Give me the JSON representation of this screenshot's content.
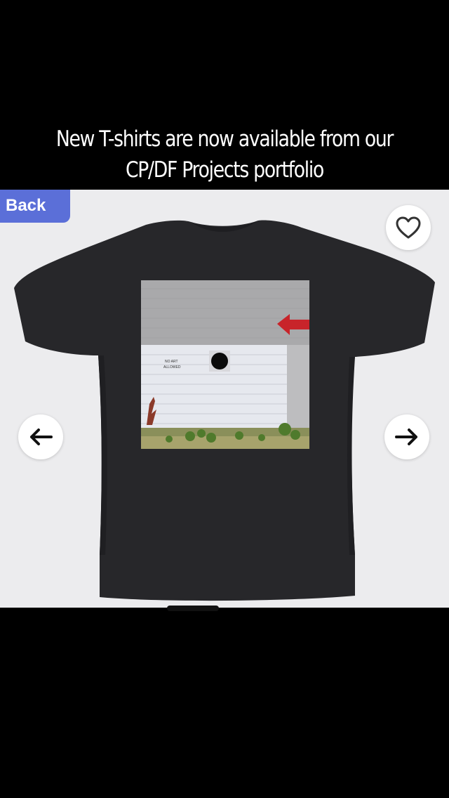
{
  "caption": {
    "line1": "New T-shirts are now available from our",
    "line2": "CP/DF Projects portfolio"
  },
  "navigation": {
    "back_label": "Back"
  },
  "icons": {
    "favorite": "heart-outline-icon",
    "previous": "arrow-left-icon",
    "next": "arrow-right-icon"
  },
  "product": {
    "name": "t-shirt-back-view",
    "shirt_color": "#27272a",
    "print_sign_text": "NO ART ALLOWED"
  },
  "colors": {
    "background": "#000000",
    "panel": "#ececee",
    "back_button": "#5b6fd8",
    "arrow_red": "#c8242a"
  }
}
